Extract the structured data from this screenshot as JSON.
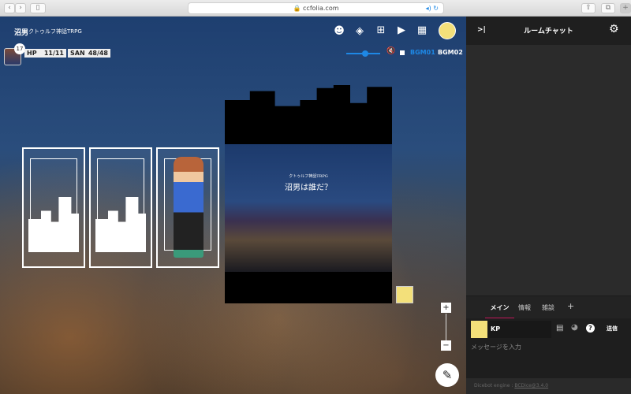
{
  "browser": {
    "url": "ccfolia.com",
    "back": "‹",
    "forward": "›",
    "sidebar": "▯",
    "share": "⇪",
    "tabs": "⧉",
    "new_tab": "+"
  },
  "room": {
    "name": "沼男",
    "system": "クトゥルフ神話TRPG"
  },
  "character": {
    "badge": "17",
    "stats": [
      {
        "label": "HP",
        "value": "11/11"
      },
      {
        "label": "SAN",
        "value": "48/48"
      }
    ]
  },
  "toolbar": {
    "icons": [
      "face-icon",
      "layers-icon",
      "add-comment-icon",
      "screen-icon",
      "movie-icon"
    ]
  },
  "audio": {
    "volume": 0.6,
    "muted": true,
    "bgm": [
      {
        "label": "BGM01",
        "color": "#1e88e5"
      },
      {
        "label": "BGM02",
        "color": "#ffffff"
      }
    ]
  },
  "scene": {
    "subtitle": "クトゥルフ神話TRPG",
    "title": "沼男は誰だ？"
  },
  "chat": {
    "title": "ルームチャット",
    "collapse": ">|",
    "tabs": [
      "メイン",
      "情報",
      "雑談"
    ],
    "add_tab": "+",
    "active_tab_color": "#c2185b",
    "speaker": "KP",
    "send": "送信",
    "placeholder": "メッセージを入力",
    "footer_prefix": "Dicebot engine : ",
    "footer_link": "BCDice@3.4.0"
  },
  "zoom": {
    "in": "+",
    "out": "−"
  },
  "fab": "✎"
}
